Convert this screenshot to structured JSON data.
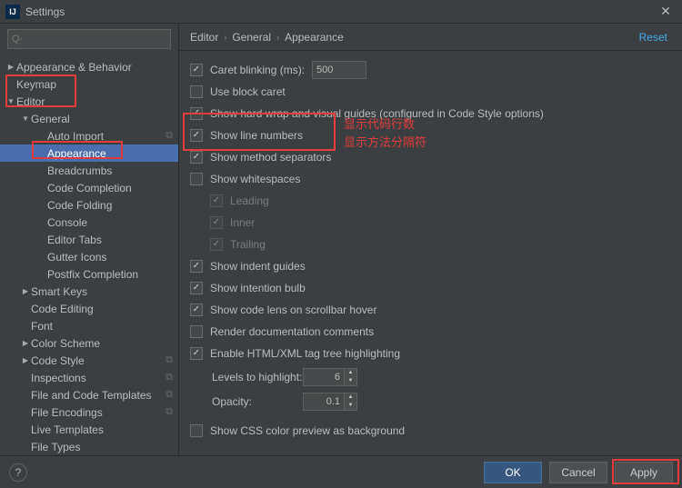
{
  "window": {
    "title": "Settings"
  },
  "search": {
    "placeholder": "Q-"
  },
  "sidebar": [
    {
      "label": "Appearance & Behavior",
      "depth": 0,
      "arrow": "▶",
      "sel": false,
      "badge": ""
    },
    {
      "label": "Keymap",
      "depth": 0,
      "arrow": "",
      "sel": false,
      "badge": ""
    },
    {
      "label": "Editor",
      "depth": 0,
      "arrow": "▼",
      "sel": false,
      "badge": ""
    },
    {
      "label": "General",
      "depth": 1,
      "arrow": "▼",
      "sel": false,
      "badge": ""
    },
    {
      "label": "Auto Import",
      "depth": 2,
      "arrow": "",
      "sel": false,
      "badge": "⧉"
    },
    {
      "label": "Appearance",
      "depth": 2,
      "arrow": "",
      "sel": true,
      "badge": ""
    },
    {
      "label": "Breadcrumbs",
      "depth": 2,
      "arrow": "",
      "sel": false,
      "badge": ""
    },
    {
      "label": "Code Completion",
      "depth": 2,
      "arrow": "",
      "sel": false,
      "badge": ""
    },
    {
      "label": "Code Folding",
      "depth": 2,
      "arrow": "",
      "sel": false,
      "badge": ""
    },
    {
      "label": "Console",
      "depth": 2,
      "arrow": "",
      "sel": false,
      "badge": ""
    },
    {
      "label": "Editor Tabs",
      "depth": 2,
      "arrow": "",
      "sel": false,
      "badge": ""
    },
    {
      "label": "Gutter Icons",
      "depth": 2,
      "arrow": "",
      "sel": false,
      "badge": ""
    },
    {
      "label": "Postfix Completion",
      "depth": 2,
      "arrow": "",
      "sel": false,
      "badge": ""
    },
    {
      "label": "Smart Keys",
      "depth": 1,
      "arrow": "▶",
      "sel": false,
      "badge": ""
    },
    {
      "label": "Code Editing",
      "depth": 1,
      "arrow": "",
      "sel": false,
      "badge": ""
    },
    {
      "label": "Font",
      "depth": 1,
      "arrow": "",
      "sel": false,
      "badge": ""
    },
    {
      "label": "Color Scheme",
      "depth": 1,
      "arrow": "▶",
      "sel": false,
      "badge": ""
    },
    {
      "label": "Code Style",
      "depth": 1,
      "arrow": "▶",
      "sel": false,
      "badge": "⧉"
    },
    {
      "label": "Inspections",
      "depth": 1,
      "arrow": "",
      "sel": false,
      "badge": "⧉"
    },
    {
      "label": "File and Code Templates",
      "depth": 1,
      "arrow": "",
      "sel": false,
      "badge": "⧉"
    },
    {
      "label": "File Encodings",
      "depth": 1,
      "arrow": "",
      "sel": false,
      "badge": "⧉"
    },
    {
      "label": "Live Templates",
      "depth": 1,
      "arrow": "",
      "sel": false,
      "badge": ""
    },
    {
      "label": "File Types",
      "depth": 1,
      "arrow": "",
      "sel": false,
      "badge": ""
    }
  ],
  "breadcrumb": {
    "a": "Editor",
    "b": "General",
    "c": "Appearance",
    "reset": "Reset"
  },
  "options": {
    "caret_blinking": {
      "label": "Caret blinking (ms):",
      "value": "500",
      "checked": true
    },
    "block_caret": {
      "label": "Use block caret",
      "checked": false
    },
    "hard_wrap": {
      "label": "Show hard wrap and visual guides (configured in Code Style options)",
      "checked": true
    },
    "line_numbers": {
      "label": "Show line numbers",
      "checked": true
    },
    "method_sep": {
      "label": "Show method separators",
      "checked": true
    },
    "whitespaces": {
      "label": "Show whitespaces",
      "checked": false
    },
    "ws_leading": {
      "label": "Leading",
      "checked": true
    },
    "ws_inner": {
      "label": "Inner",
      "checked": true
    },
    "ws_trailing": {
      "label": "Trailing",
      "checked": true
    },
    "indent_guides": {
      "label": "Show indent guides",
      "checked": true
    },
    "intention_bulb": {
      "label": "Show intention bulb",
      "checked": true
    },
    "code_lens": {
      "label": "Show code lens on scrollbar hover",
      "checked": true
    },
    "doc_comments": {
      "label": "Render documentation comments",
      "checked": false
    },
    "tag_tree": {
      "label": "Enable HTML/XML tag tree highlighting",
      "checked": true
    },
    "levels": {
      "label": "Levels to highlight:",
      "value": "6"
    },
    "opacity": {
      "label": "Opacity:",
      "value": "0.1"
    },
    "css_preview": {
      "label": "Show CSS color preview as background",
      "checked": false
    }
  },
  "annotations": {
    "line_numbers": "显示代码行数",
    "method_sep": "显示方法分隔符"
  },
  "footer": {
    "ok": "OK",
    "cancel": "Cancel",
    "apply": "Apply"
  }
}
